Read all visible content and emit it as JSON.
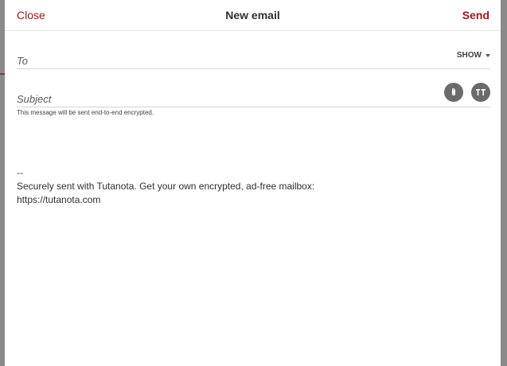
{
  "header": {
    "close_label": "Close",
    "title": "New email",
    "send_label": "Send"
  },
  "to": {
    "label": "To",
    "value": "",
    "show_label": "SHOW"
  },
  "subject": {
    "label": "Subject",
    "value": ""
  },
  "hint": "This message will be sent end-to-end encrypted.",
  "body": {
    "separator": "--",
    "signature_line1": "Securely sent with Tutanota. Get your own encrypted, ad-free mailbox:",
    "signature_line2": "https://tutanota.com"
  },
  "icons": {
    "attach": "paperclip-icon",
    "format": "text-format-icon",
    "show": "chevron-down-icon"
  },
  "colors": {
    "accent": "#a01520",
    "icon_button_bg": "#6b6b6b"
  }
}
